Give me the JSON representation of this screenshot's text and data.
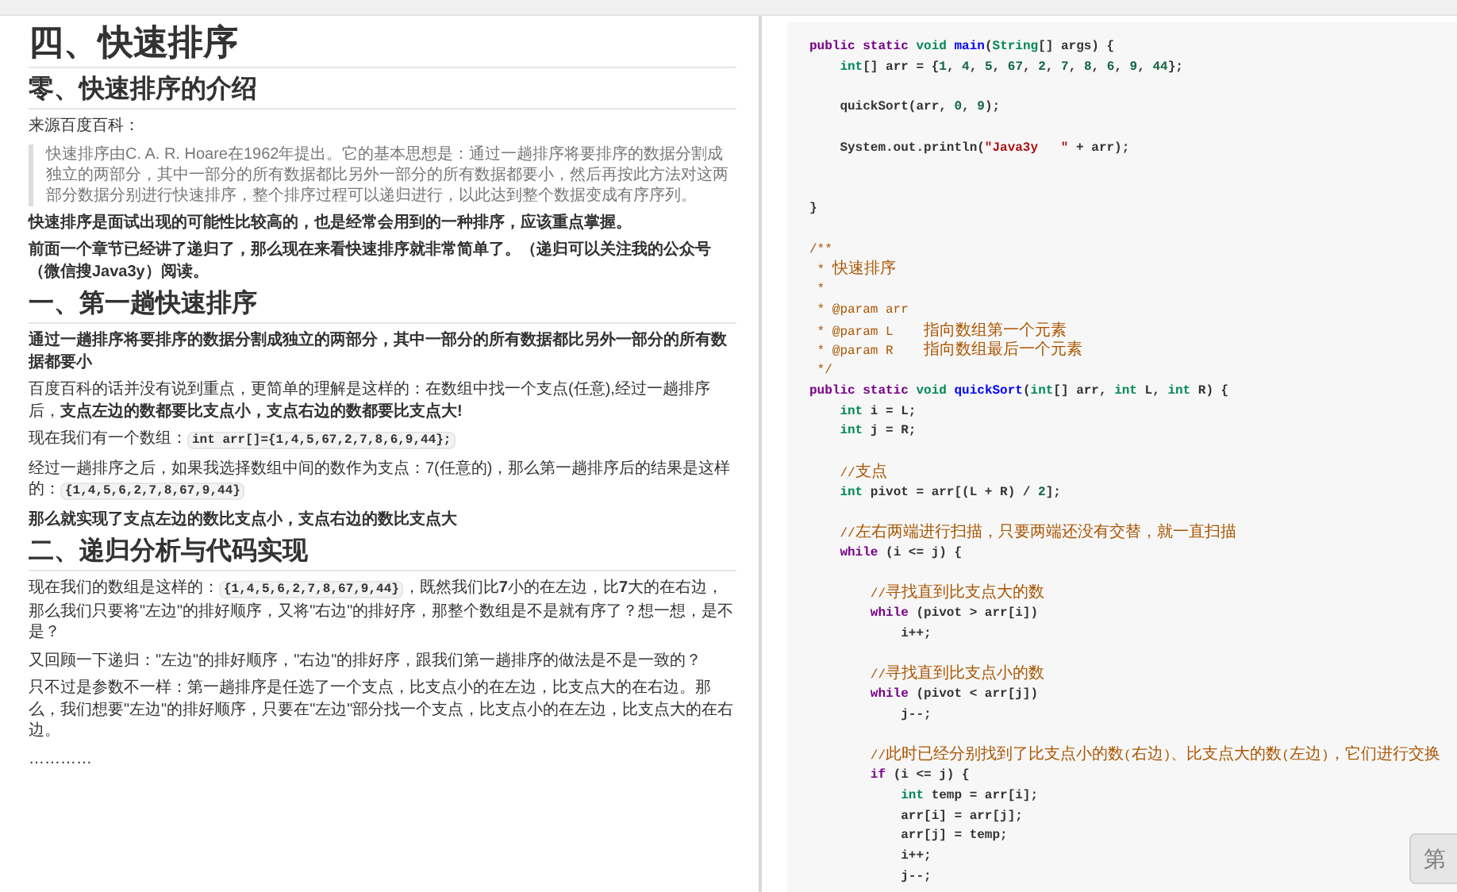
{
  "left_page": {
    "blocks": [
      {
        "kind": "h1",
        "text": "四、快速排序"
      },
      {
        "kind": "h2",
        "text": "零、快速排序的介绍"
      },
      {
        "kind": "p",
        "bold": false,
        "parts": [
          {
            "kind": "text",
            "text": "来源百度百科："
          }
        ]
      },
      {
        "kind": "quote",
        "text": "快速排序由C. A. R. Hoare在1962年提出。它的基本思想是：通过一趟排序将要排序的数据分割成独立的两部分，其中一部分的所有数据都比另外一部分的所有数据都要小，然后再按此方法对这两部分数据分别进行快速排序，整个排序过程可以递归进行，以此达到整个数据变成有序序列。"
      },
      {
        "kind": "p",
        "bold": true,
        "parts": [
          {
            "kind": "text",
            "text": "快速排序是面试出现的可能性比较高的，也是经常会用到的一种排序，应该重点掌握。"
          }
        ]
      },
      {
        "kind": "p",
        "bold": true,
        "parts": [
          {
            "kind": "text",
            "text": "前面一个章节已经讲了递归了，那么现在来看快速排序就非常简单了。（递归可以关注我的公众号（微信搜Java3y）阅读。"
          }
        ]
      },
      {
        "kind": "h2",
        "text": "一、第一趟快速排序"
      },
      {
        "kind": "p",
        "bold": true,
        "parts": [
          {
            "kind": "text",
            "text": "通过一趟排序将要排序的数据分割成独立的两部分，其中一部分的所有数据都比另外一部分的所有数据都要小"
          }
        ]
      },
      {
        "kind": "p",
        "bold": false,
        "parts": [
          {
            "kind": "text",
            "text": "百度百科的话并没有说到重点，更简单的理解是这样的：在数组中找一个支点(任意),经过一趟排序后，**支点左边的数都要比支点小，支点右边的数都要比支点大!**"
          }
        ]
      },
      {
        "kind": "p",
        "bold": false,
        "parts": [
          {
            "kind": "text",
            "text": "现在我们有一个数组："
          },
          {
            "kind": "code",
            "text": "int arr[]={1,4,5,67,2,7,8,6,9,44};"
          }
        ]
      },
      {
        "kind": "p",
        "bold": false,
        "parts": [
          {
            "kind": "text",
            "text": "经过一趟排序之后，如果我选择数组中间的数作为支点：7(任意的)，那么第一趟排序后的结果是这样的："
          },
          {
            "kind": "code",
            "text": "{1,4,5,6,2,7,8,67,9,44}"
          }
        ]
      },
      {
        "kind": "p",
        "bold": true,
        "parts": [
          {
            "kind": "text",
            "text": "那么就实现了支点左边的数比支点小，支点右边的数比支点大"
          }
        ]
      },
      {
        "kind": "h2",
        "text": "二、递归分析与代码实现"
      },
      {
        "kind": "p",
        "bold": false,
        "parts": [
          {
            "kind": "text",
            "text": "现在我们的数组是这样的："
          },
          {
            "kind": "code",
            "text": "{1,4,5,6,2,7,8,67,9,44}"
          },
          {
            "kind": "text",
            "text": "，既然我们比**7**小的在左边，比**7**大的在右边，那么我们只要将\"左边\"的排好顺序，又将\"右边\"的排好序，那整个数组是不是就有序了？想一想，是不是？"
          }
        ]
      },
      {
        "kind": "p",
        "bold": false,
        "parts": [
          {
            "kind": "text",
            "text": "又回顾一下递归：\"左边\"的排好顺序，\"右边\"的排好序，跟我们第一趟排序的做法是不是一致的？"
          }
        ]
      },
      {
        "kind": "p",
        "bold": false,
        "parts": [
          {
            "kind": "text",
            "text": "只不过是参数不一样：第一趟排序是任选了一个支点，比支点小的在左边，比支点大的在右边。那么，我们想要\"左边\"的排好顺序，只要在\"左边\"部分找一个支点，比支点小的在左边，比支点大的在右边。"
          }
        ]
      },
      {
        "kind": "p",
        "bold": false,
        "parts": [
          {
            "kind": "text",
            "text": "…………"
          }
        ]
      }
    ]
  },
  "code_block": {
    "lines": [
      {
        "kind": "code",
        "tokens": [
          {
            "kind": "keyword",
            "text": "public static"
          },
          {
            "kind": "type",
            "text": " void"
          },
          {
            "kind": "function",
            "text": " main"
          },
          {
            "kind": "plain",
            "text": "("
          },
          {
            "kind": "type",
            "text": "String"
          },
          {
            "kind": "plain",
            "text": "[] args) {"
          }
        ]
      },
      {
        "kind": "code",
        "tokens": [
          {
            "kind": "type",
            "text": "    int"
          },
          {
            "kind": "plain",
            "text": "[] arr = {"
          },
          {
            "kind": "number",
            "text": "1"
          },
          {
            "kind": "plain",
            "text": ", "
          },
          {
            "kind": "number",
            "text": "4"
          },
          {
            "kind": "plain",
            "text": ", "
          },
          {
            "kind": "number",
            "text": "5"
          },
          {
            "kind": "plain",
            "text": ", "
          },
          {
            "kind": "number",
            "text": "67"
          },
          {
            "kind": "plain",
            "text": ", "
          },
          {
            "kind": "number",
            "text": "2"
          },
          {
            "kind": "plain",
            "text": ", "
          },
          {
            "kind": "number",
            "text": "7"
          },
          {
            "kind": "plain",
            "text": ", "
          },
          {
            "kind": "number",
            "text": "8"
          },
          {
            "kind": "plain",
            "text": ", "
          },
          {
            "kind": "number",
            "text": "6"
          },
          {
            "kind": "plain",
            "text": ", "
          },
          {
            "kind": "number",
            "text": "9"
          },
          {
            "kind": "plain",
            "text": ", "
          },
          {
            "kind": "number",
            "text": "44"
          },
          {
            "kind": "plain",
            "text": "};"
          }
        ]
      },
      {
        "kind": "blank"
      },
      {
        "kind": "code",
        "tokens": [
          {
            "kind": "plain",
            "text": "    quickSort(arr, "
          },
          {
            "kind": "number",
            "text": "0"
          },
          {
            "kind": "plain",
            "text": ", "
          },
          {
            "kind": "number",
            "text": "9"
          },
          {
            "kind": "plain",
            "text": ");"
          }
        ]
      },
      {
        "kind": "blank"
      },
      {
        "kind": "code",
        "tokens": [
          {
            "kind": "plain",
            "text": "    System.out.println("
          },
          {
            "kind": "string",
            "text": "\"Java3y   \""
          },
          {
            "kind": "plain",
            "text": " + arr);"
          }
        ]
      },
      {
        "kind": "blank"
      },
      {
        "kind": "blank"
      },
      {
        "kind": "code",
        "tokens": [
          {
            "kind": "plain",
            "text": "}"
          }
        ]
      },
      {
        "kind": "blank"
      },
      {
        "kind": "code",
        "tokens": [
          {
            "kind": "comment",
            "text": "/**"
          }
        ]
      },
      {
        "kind": "code",
        "tokens": [
          {
            "kind": "comment",
            "text": " * 快速排序"
          }
        ]
      },
      {
        "kind": "code",
        "tokens": [
          {
            "kind": "comment",
            "text": " *"
          }
        ]
      },
      {
        "kind": "code",
        "tokens": [
          {
            "kind": "comment",
            "text": " * @param arr"
          }
        ]
      },
      {
        "kind": "code",
        "tokens": [
          {
            "kind": "comment",
            "text": " * @param L    指向数组第一个元素"
          }
        ]
      },
      {
        "kind": "code",
        "tokens": [
          {
            "kind": "comment",
            "text": " * @param R    指向数组最后一个元素"
          }
        ]
      },
      {
        "kind": "code",
        "tokens": [
          {
            "kind": "comment",
            "text": " */"
          }
        ]
      },
      {
        "kind": "code",
        "tokens": [
          {
            "kind": "keyword",
            "text": "public static"
          },
          {
            "kind": "type",
            "text": " void"
          },
          {
            "kind": "function",
            "text": " quickSort"
          },
          {
            "kind": "plain",
            "text": "("
          },
          {
            "kind": "type",
            "text": "int"
          },
          {
            "kind": "plain",
            "text": "[] arr, "
          },
          {
            "kind": "type",
            "text": "int"
          },
          {
            "kind": "plain",
            "text": " L, "
          },
          {
            "kind": "type",
            "text": "int"
          },
          {
            "kind": "plain",
            "text": " R) {"
          }
        ]
      },
      {
        "kind": "code",
        "tokens": [
          {
            "kind": "type",
            "text": "    int"
          },
          {
            "kind": "plain",
            "text": " i = L;"
          }
        ]
      },
      {
        "kind": "code",
        "tokens": [
          {
            "kind": "type",
            "text": "    int"
          },
          {
            "kind": "plain",
            "text": " j = R;"
          }
        ]
      },
      {
        "kind": "blank"
      },
      {
        "kind": "code",
        "tokens": [
          {
            "kind": "comment",
            "text": "    //支点"
          }
        ]
      },
      {
        "kind": "code",
        "tokens": [
          {
            "kind": "type",
            "text": "    int"
          },
          {
            "kind": "plain",
            "text": " pivot = arr[(L + R) / "
          },
          {
            "kind": "number",
            "text": "2"
          },
          {
            "kind": "plain",
            "text": "];"
          }
        ]
      },
      {
        "kind": "blank"
      },
      {
        "kind": "code",
        "tokens": [
          {
            "kind": "comment",
            "text": "    //左右两端进行扫描，只要两端还没有交替，就一直扫描"
          }
        ]
      },
      {
        "kind": "code",
        "tokens": [
          {
            "kind": "keyword",
            "text": "    while"
          },
          {
            "kind": "plain",
            "text": " (i <= j) {"
          }
        ]
      },
      {
        "kind": "blank"
      },
      {
        "kind": "code",
        "tokens": [
          {
            "kind": "comment",
            "text": "        //寻找直到比支点大的数"
          }
        ]
      },
      {
        "kind": "code",
        "tokens": [
          {
            "kind": "keyword",
            "text": "        while"
          },
          {
            "kind": "plain",
            "text": " (pivot > arr[i])"
          }
        ]
      },
      {
        "kind": "code",
        "tokens": [
          {
            "kind": "plain",
            "text": "            i++;"
          }
        ]
      },
      {
        "kind": "blank"
      },
      {
        "kind": "code",
        "tokens": [
          {
            "kind": "comment",
            "text": "        //寻找直到比支点小的数"
          }
        ]
      },
      {
        "kind": "code",
        "tokens": [
          {
            "kind": "keyword",
            "text": "        while"
          },
          {
            "kind": "plain",
            "text": " (pivot < arr[j])"
          }
        ]
      },
      {
        "kind": "code",
        "tokens": [
          {
            "kind": "plain",
            "text": "            j--;"
          }
        ]
      },
      {
        "kind": "blank"
      },
      {
        "kind": "code",
        "tokens": [
          {
            "kind": "comment",
            "text": "        //此时已经分别找到了比支点小的数(右边)、比支点大的数(左边)，它们进行交换"
          }
        ]
      },
      {
        "kind": "code",
        "tokens": [
          {
            "kind": "keyword",
            "text": "        if"
          },
          {
            "kind": "plain",
            "text": " (i <= j) {"
          }
        ]
      },
      {
        "kind": "code",
        "tokens": [
          {
            "kind": "type",
            "text": "            int"
          },
          {
            "kind": "plain",
            "text": " temp = arr[i];"
          }
        ]
      },
      {
        "kind": "code",
        "tokens": [
          {
            "kind": "plain",
            "text": "            arr[i] = arr[j];"
          }
        ]
      },
      {
        "kind": "code",
        "tokens": [
          {
            "kind": "plain",
            "text": "            arr[j] = temp;"
          }
        ]
      },
      {
        "kind": "code",
        "tokens": [
          {
            "kind": "plain",
            "text": "            i++;"
          }
        ]
      },
      {
        "kind": "code",
        "tokens": [
          {
            "kind": "plain",
            "text": "            j--;"
          }
        ]
      }
    ]
  },
  "floating_button": {
    "label": "第"
  }
}
